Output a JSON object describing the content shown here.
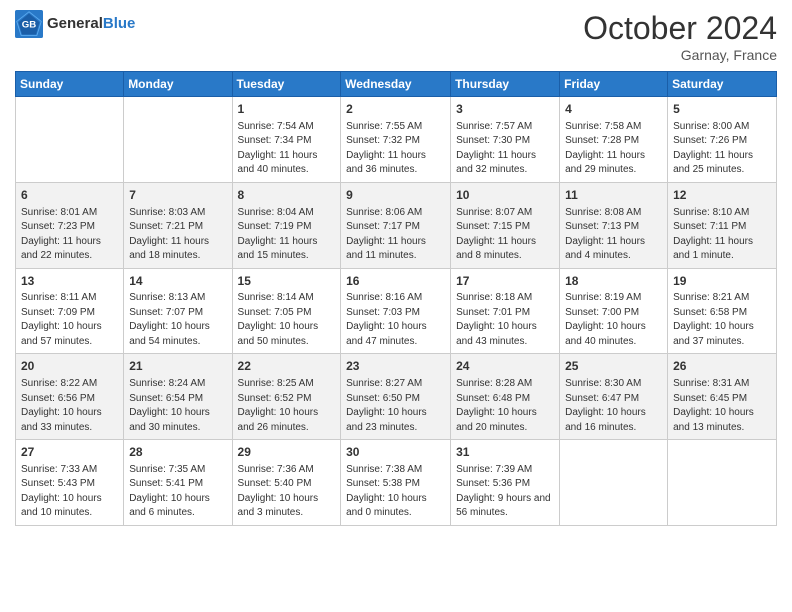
{
  "logo": {
    "general": "General",
    "blue": "Blue"
  },
  "title": "October 2024",
  "subtitle": "Garnay, France",
  "headers": [
    "Sunday",
    "Monday",
    "Tuesday",
    "Wednesday",
    "Thursday",
    "Friday",
    "Saturday"
  ],
  "weeks": [
    [
      {
        "day": "",
        "sunrise": "",
        "sunset": "",
        "daylight": ""
      },
      {
        "day": "",
        "sunrise": "",
        "sunset": "",
        "daylight": ""
      },
      {
        "day": "1",
        "sunrise": "Sunrise: 7:54 AM",
        "sunset": "Sunset: 7:34 PM",
        "daylight": "Daylight: 11 hours and 40 minutes."
      },
      {
        "day": "2",
        "sunrise": "Sunrise: 7:55 AM",
        "sunset": "Sunset: 7:32 PM",
        "daylight": "Daylight: 11 hours and 36 minutes."
      },
      {
        "day": "3",
        "sunrise": "Sunrise: 7:57 AM",
        "sunset": "Sunset: 7:30 PM",
        "daylight": "Daylight: 11 hours and 32 minutes."
      },
      {
        "day": "4",
        "sunrise": "Sunrise: 7:58 AM",
        "sunset": "Sunset: 7:28 PM",
        "daylight": "Daylight: 11 hours and 29 minutes."
      },
      {
        "day": "5",
        "sunrise": "Sunrise: 8:00 AM",
        "sunset": "Sunset: 7:26 PM",
        "daylight": "Daylight: 11 hours and 25 minutes."
      }
    ],
    [
      {
        "day": "6",
        "sunrise": "Sunrise: 8:01 AM",
        "sunset": "Sunset: 7:23 PM",
        "daylight": "Daylight: 11 hours and 22 minutes."
      },
      {
        "day": "7",
        "sunrise": "Sunrise: 8:03 AM",
        "sunset": "Sunset: 7:21 PM",
        "daylight": "Daylight: 11 hours and 18 minutes."
      },
      {
        "day": "8",
        "sunrise": "Sunrise: 8:04 AM",
        "sunset": "Sunset: 7:19 PM",
        "daylight": "Daylight: 11 hours and 15 minutes."
      },
      {
        "day": "9",
        "sunrise": "Sunrise: 8:06 AM",
        "sunset": "Sunset: 7:17 PM",
        "daylight": "Daylight: 11 hours and 11 minutes."
      },
      {
        "day": "10",
        "sunrise": "Sunrise: 8:07 AM",
        "sunset": "Sunset: 7:15 PM",
        "daylight": "Daylight: 11 hours and 8 minutes."
      },
      {
        "day": "11",
        "sunrise": "Sunrise: 8:08 AM",
        "sunset": "Sunset: 7:13 PM",
        "daylight": "Daylight: 11 hours and 4 minutes."
      },
      {
        "day": "12",
        "sunrise": "Sunrise: 8:10 AM",
        "sunset": "Sunset: 7:11 PM",
        "daylight": "Daylight: 11 hours and 1 minute."
      }
    ],
    [
      {
        "day": "13",
        "sunrise": "Sunrise: 8:11 AM",
        "sunset": "Sunset: 7:09 PM",
        "daylight": "Daylight: 10 hours and 57 minutes."
      },
      {
        "day": "14",
        "sunrise": "Sunrise: 8:13 AM",
        "sunset": "Sunset: 7:07 PM",
        "daylight": "Daylight: 10 hours and 54 minutes."
      },
      {
        "day": "15",
        "sunrise": "Sunrise: 8:14 AM",
        "sunset": "Sunset: 7:05 PM",
        "daylight": "Daylight: 10 hours and 50 minutes."
      },
      {
        "day": "16",
        "sunrise": "Sunrise: 8:16 AM",
        "sunset": "Sunset: 7:03 PM",
        "daylight": "Daylight: 10 hours and 47 minutes."
      },
      {
        "day": "17",
        "sunrise": "Sunrise: 8:18 AM",
        "sunset": "Sunset: 7:01 PM",
        "daylight": "Daylight: 10 hours and 43 minutes."
      },
      {
        "day": "18",
        "sunrise": "Sunrise: 8:19 AM",
        "sunset": "Sunset: 7:00 PM",
        "daylight": "Daylight: 10 hours and 40 minutes."
      },
      {
        "day": "19",
        "sunrise": "Sunrise: 8:21 AM",
        "sunset": "Sunset: 6:58 PM",
        "daylight": "Daylight: 10 hours and 37 minutes."
      }
    ],
    [
      {
        "day": "20",
        "sunrise": "Sunrise: 8:22 AM",
        "sunset": "Sunset: 6:56 PM",
        "daylight": "Daylight: 10 hours and 33 minutes."
      },
      {
        "day": "21",
        "sunrise": "Sunrise: 8:24 AM",
        "sunset": "Sunset: 6:54 PM",
        "daylight": "Daylight: 10 hours and 30 minutes."
      },
      {
        "day": "22",
        "sunrise": "Sunrise: 8:25 AM",
        "sunset": "Sunset: 6:52 PM",
        "daylight": "Daylight: 10 hours and 26 minutes."
      },
      {
        "day": "23",
        "sunrise": "Sunrise: 8:27 AM",
        "sunset": "Sunset: 6:50 PM",
        "daylight": "Daylight: 10 hours and 23 minutes."
      },
      {
        "day": "24",
        "sunrise": "Sunrise: 8:28 AM",
        "sunset": "Sunset: 6:48 PM",
        "daylight": "Daylight: 10 hours and 20 minutes."
      },
      {
        "day": "25",
        "sunrise": "Sunrise: 8:30 AM",
        "sunset": "Sunset: 6:47 PM",
        "daylight": "Daylight: 10 hours and 16 minutes."
      },
      {
        "day": "26",
        "sunrise": "Sunrise: 8:31 AM",
        "sunset": "Sunset: 6:45 PM",
        "daylight": "Daylight: 10 hours and 13 minutes."
      }
    ],
    [
      {
        "day": "27",
        "sunrise": "Sunrise: 7:33 AM",
        "sunset": "Sunset: 5:43 PM",
        "daylight": "Daylight: 10 hours and 10 minutes."
      },
      {
        "day": "28",
        "sunrise": "Sunrise: 7:35 AM",
        "sunset": "Sunset: 5:41 PM",
        "daylight": "Daylight: 10 hours and 6 minutes."
      },
      {
        "day": "29",
        "sunrise": "Sunrise: 7:36 AM",
        "sunset": "Sunset: 5:40 PM",
        "daylight": "Daylight: 10 hours and 3 minutes."
      },
      {
        "day": "30",
        "sunrise": "Sunrise: 7:38 AM",
        "sunset": "Sunset: 5:38 PM",
        "daylight": "Daylight: 10 hours and 0 minutes."
      },
      {
        "day": "31",
        "sunrise": "Sunrise: 7:39 AM",
        "sunset": "Sunset: 5:36 PM",
        "daylight": "Daylight: 9 hours and 56 minutes."
      },
      {
        "day": "",
        "sunrise": "",
        "sunset": "",
        "daylight": ""
      },
      {
        "day": "",
        "sunrise": "",
        "sunset": "",
        "daylight": ""
      }
    ]
  ]
}
